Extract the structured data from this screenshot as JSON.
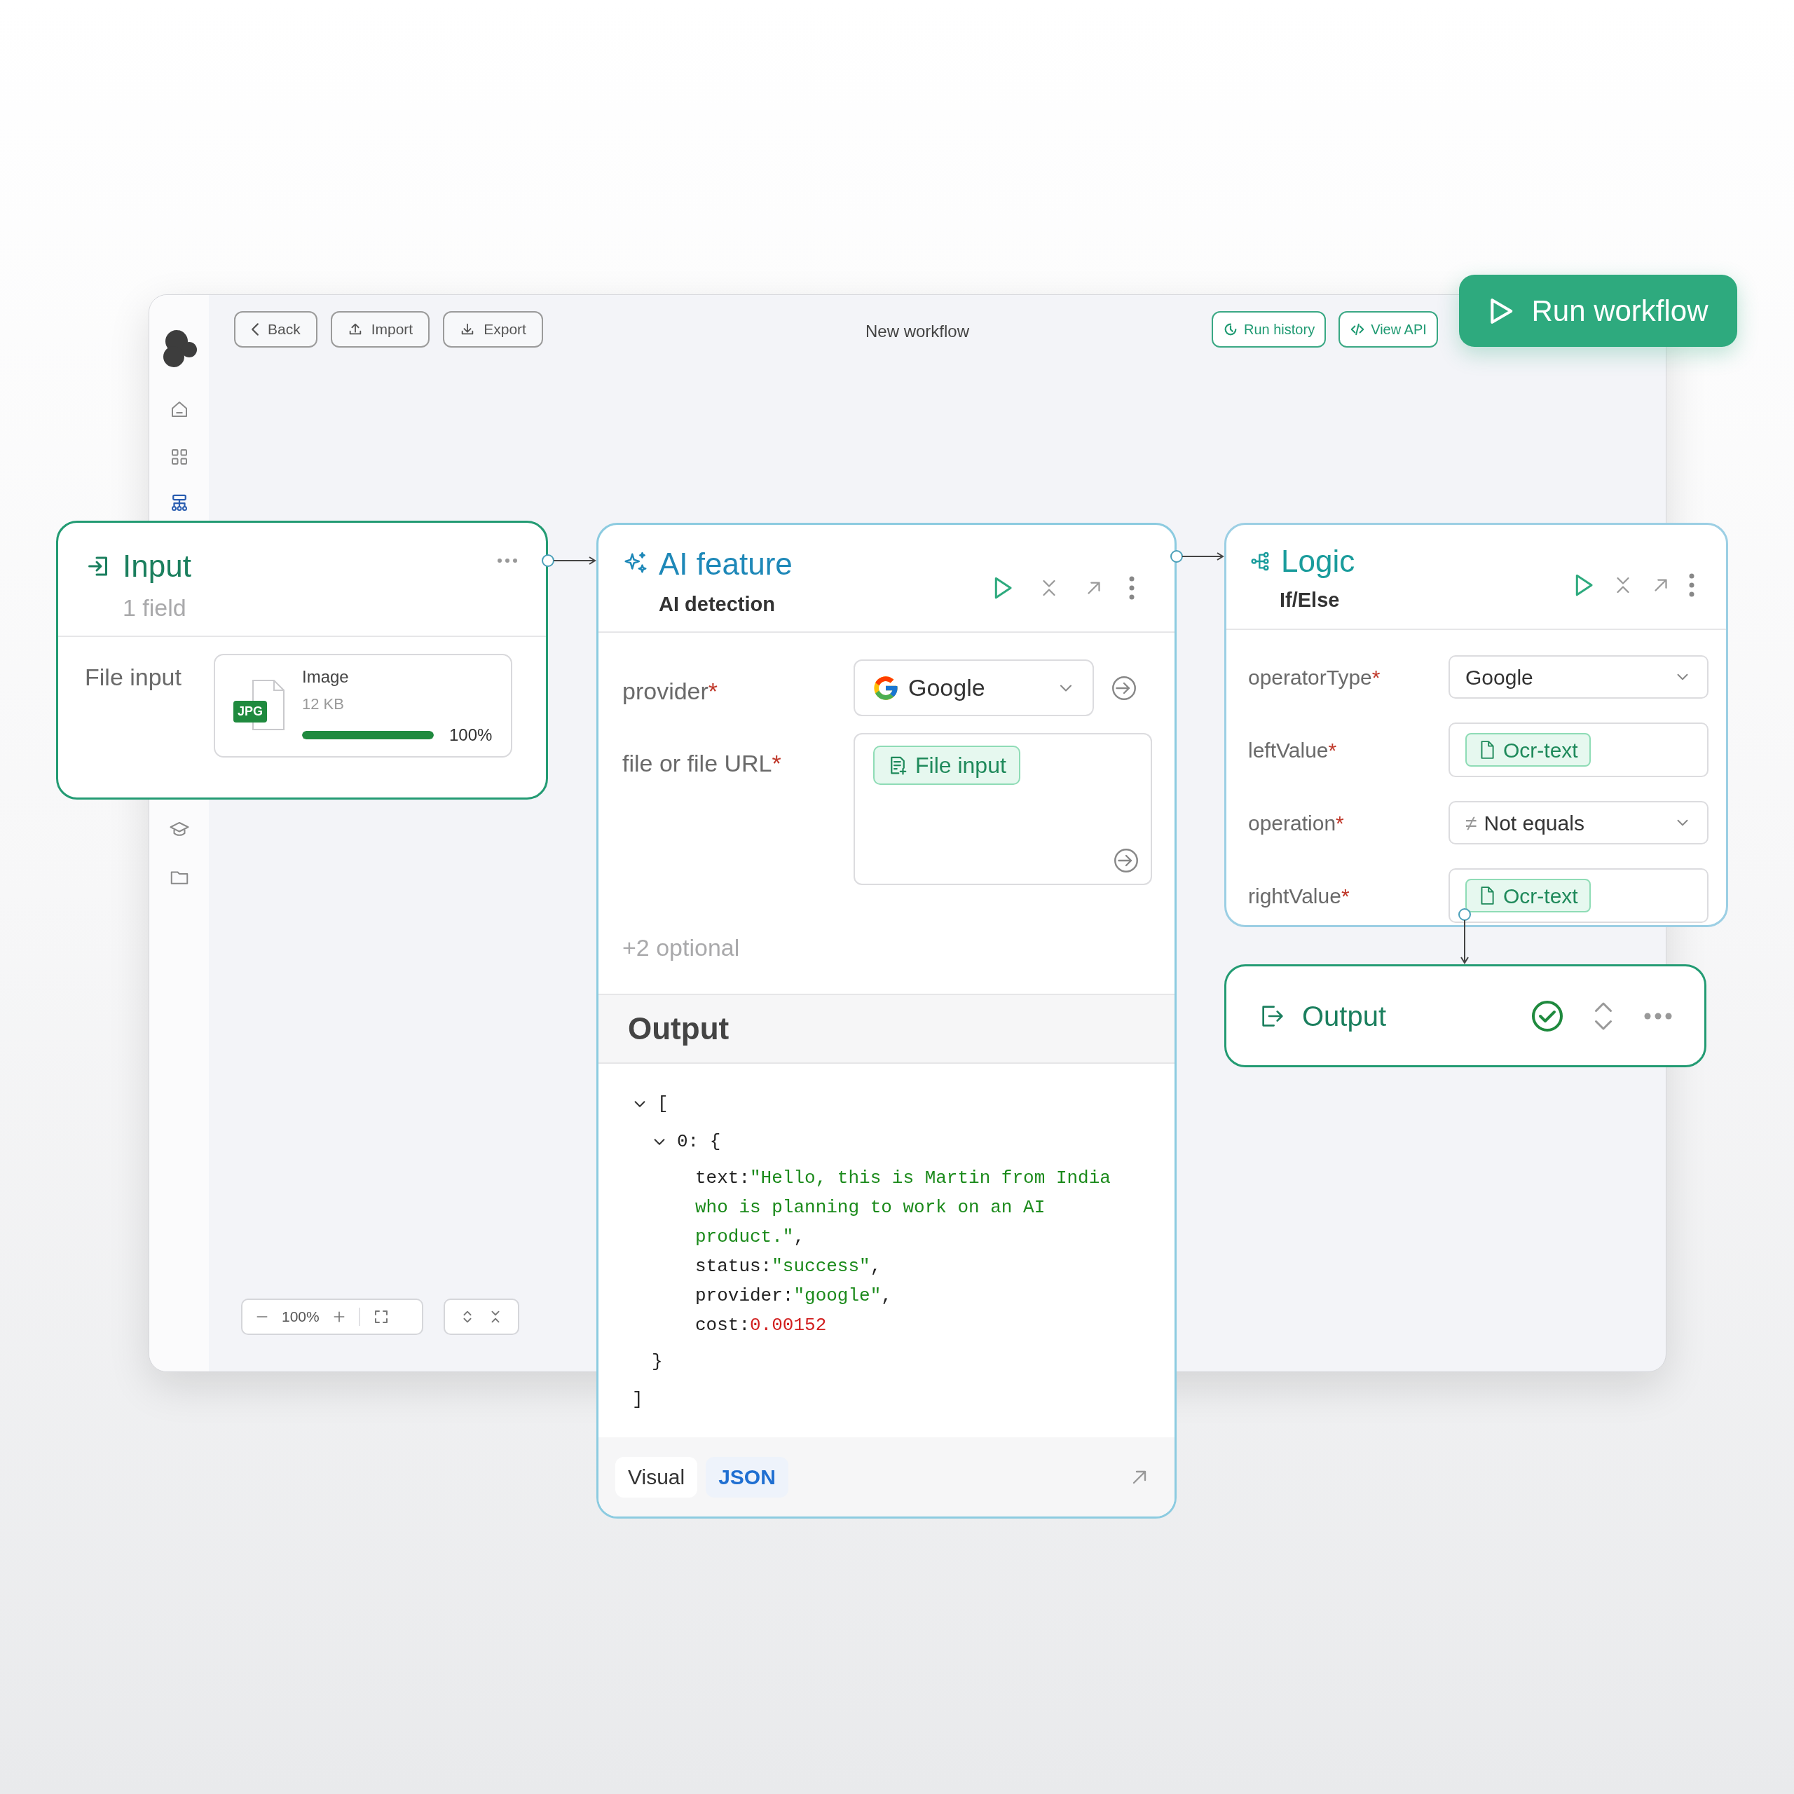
{
  "toolbar": {
    "buttons": [
      {
        "label": "Back",
        "kind": "back"
      },
      {
        "label": "Import",
        "kind": "import"
      },
      {
        "label": "Export",
        "kind": "export"
      }
    ],
    "title": "New workflow",
    "actions": [
      {
        "label": "Run history",
        "kind": "history"
      },
      {
        "label": "View API",
        "kind": "api"
      }
    ],
    "primary": {
      "label": "Run workflow"
    }
  },
  "sidebar": {
    "items": [
      {
        "kind": "home",
        "selected": false
      },
      {
        "kind": "grid",
        "selected": false
      },
      {
        "kind": "flow",
        "selected": true
      },
      {
        "kind": "learn",
        "selected": false
      },
      {
        "kind": "folder",
        "selected": false
      }
    ]
  },
  "input_node": {
    "title": "Input",
    "subtitle": "1 field",
    "field_label": "File input",
    "file": {
      "badge": "JPG",
      "name": "Image",
      "size": "12 KB",
      "level": 1,
      "reading": "100%"
    }
  },
  "ai_node": {
    "title": "AI feature",
    "subtitle": "AI detection",
    "fields": [
      {
        "label": "provider",
        "required_mark": "*",
        "kind": "select",
        "value": "Google"
      },
      {
        "label": "file or file URL",
        "required_mark": "*",
        "kind": "chip_area",
        "value": "File input"
      }
    ],
    "more": "+2 optional",
    "output": {
      "title": "Output",
      "tree": {
        "expanded": true,
        "open": "[",
        "close": "]",
        "children": [
          {
            "expanded": true,
            "open": "0: {",
            "close": "}",
            "entries": [
              {
                "key": "text:",
                "value": "\"Hello, this is Martin from India who is planning to work on an AI product.\"",
                "kind": "string",
                "suffix": ","
              },
              {
                "key": "status:",
                "value": "\"success\"",
                "kind": "string",
                "suffix": ","
              },
              {
                "key": "provider:",
                "value": "\"google\"",
                "kind": "string",
                "suffix": ","
              },
              {
                "key": "cost:",
                "value": "0.00152",
                "kind": "number"
              }
            ]
          }
        ]
      },
      "tabs": [
        {
          "label": "Visual",
          "selected": false
        },
        {
          "label": "JSON",
          "selected": true
        }
      ]
    }
  },
  "logic_node": {
    "title": "Logic",
    "subtitle": "If/Else",
    "fields": [
      {
        "label": "operatorType",
        "required_mark": "*",
        "kind": "select",
        "value": "Google"
      },
      {
        "label": "leftValue",
        "required_mark": "*",
        "kind": "chip",
        "value": "Ocr-text"
      },
      {
        "label": "operation",
        "required_mark": "*",
        "kind": "select",
        "prefix": "≠",
        "value": "Not equals"
      },
      {
        "label": "rightValue",
        "required_mark": "*",
        "kind": "chip",
        "value": "Ocr-text"
      }
    ]
  },
  "output_node": {
    "title": "Output",
    "succeeded": true
  },
  "zoom_controls": {
    "zoom": "100%"
  }
}
